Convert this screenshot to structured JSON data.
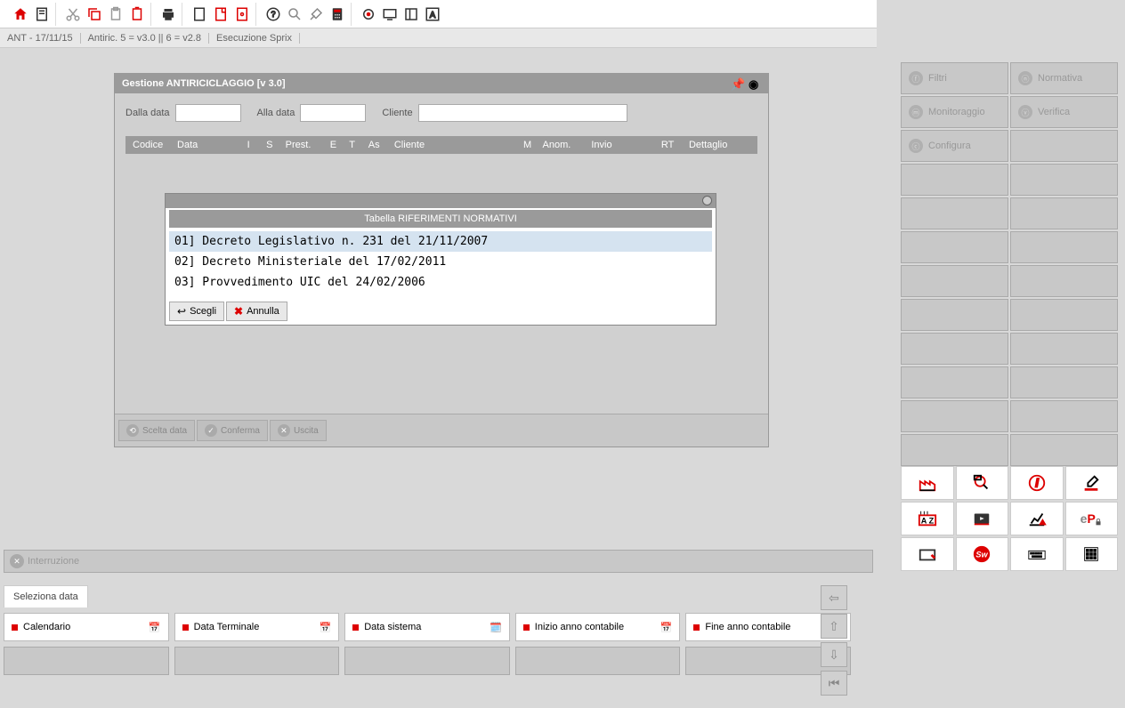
{
  "breadcrumb": {
    "item1": "ANT - 17/11/15",
    "item2": "Antiric. 5 = v3.0 || 6 = v2.8",
    "item3": "Esecuzione Sprix"
  },
  "window": {
    "title": "Gestione ANTIRICICLAGGIO [v 3.0]",
    "filters": {
      "dalla_data_label": "Dalla data",
      "alla_data_label": "Alla data",
      "cliente_label": "Cliente",
      "dalla_data": "",
      "alla_data": "",
      "cliente": ""
    },
    "table_headers": {
      "codice": "Codice",
      "data": "Data",
      "i": "I",
      "s": "S",
      "prest": "Prest.",
      "e": "E",
      "t": "T",
      "as": "As",
      "cliente": "Cliente",
      "m": "M",
      "anom": "Anom.",
      "invio": "Invio",
      "rt": "RT",
      "dettaglio": "Dettaglio"
    },
    "footer": {
      "scelta_data": "Scelta data",
      "conferma": "Conferma",
      "uscita": "Uscita"
    }
  },
  "popup": {
    "title": "Tabella RIFERIMENTI NORMATIVI",
    "rows": [
      "01] Decreto Legislativo n. 231 del 21/11/2007",
      "02] Decreto Ministeriale del 17/02/2011",
      "03] Provvedimento UIC del 24/02/2006"
    ],
    "scegli": "Scegli",
    "annulla": "Annulla"
  },
  "interrupt": {
    "label": "Interruzione"
  },
  "bottom": {
    "tab": "Seleziona data",
    "buttons": {
      "calendario": "Calendario",
      "data_terminale": "Data Terminale",
      "data_sistema": "Data sistema",
      "inizio_anno": "Inizio anno contabile",
      "fine_anno": "Fine anno contabile"
    }
  },
  "side": {
    "filtri": "Filtri",
    "normativa": "Normativa",
    "monitoraggio": "Monitoraggio",
    "verifica": "Verifica",
    "configura": "Configura"
  }
}
